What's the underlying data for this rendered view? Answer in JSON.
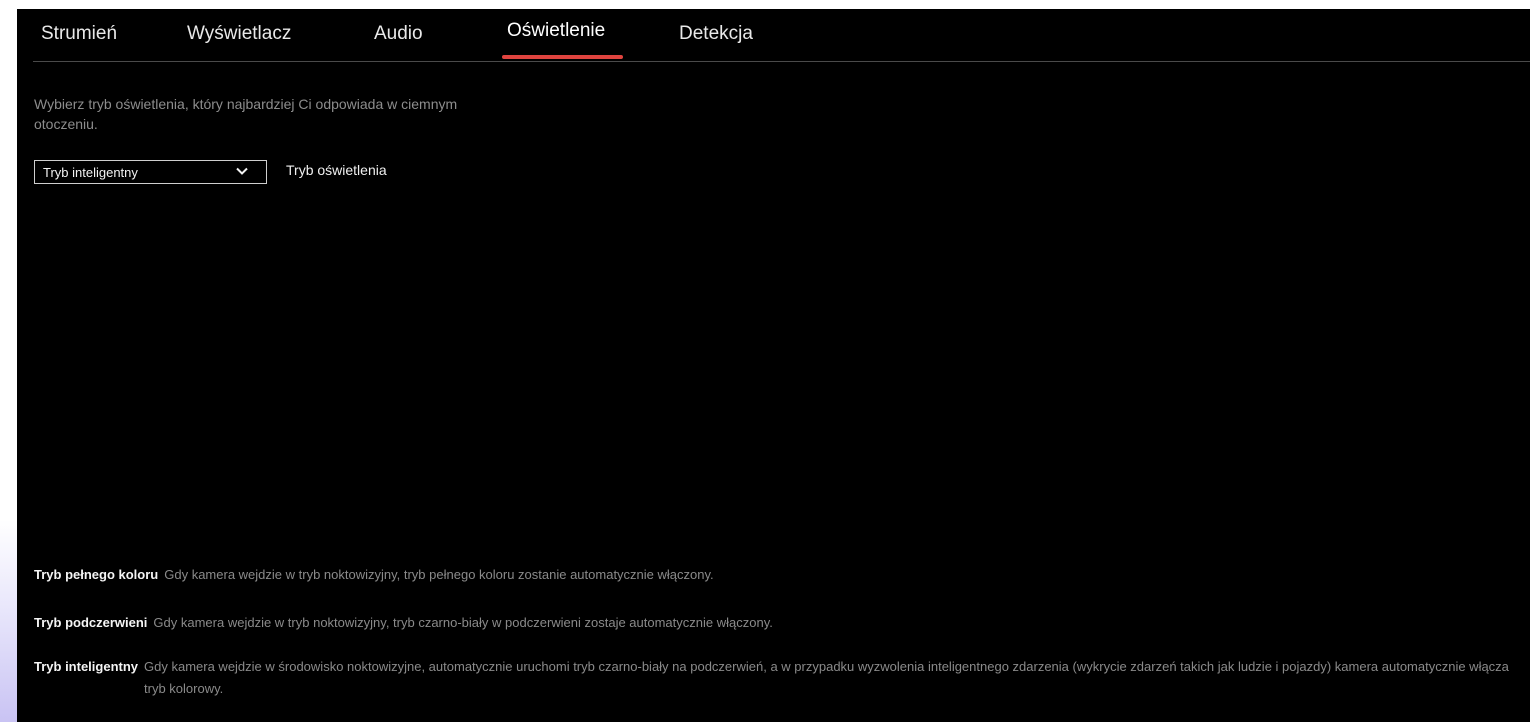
{
  "tabs": [
    {
      "label": "Strumień",
      "active": false
    },
    {
      "label": "Wyświetlacz",
      "active": false
    },
    {
      "label": "Audio",
      "active": false
    },
    {
      "label": "Oświetlenie",
      "active": true
    },
    {
      "label": "Detekcja",
      "active": false
    }
  ],
  "accent_color": "#e0443f",
  "intro_text": "Wybierz tryb oświetlenia, który najbardziej Ci odpowiada w ciemnym otoczeniu.",
  "lighting_mode": {
    "selected": "Tryb inteligentny",
    "label": "Tryb oświetlenia",
    "icon": "chevron-down-icon"
  },
  "descriptions": [
    {
      "term": "Tryb pełnego koloru",
      "text": "Gdy kamera wejdzie w tryb noktowizyjny, tryb pełnego koloru zostanie automatycznie włączony."
    },
    {
      "term": "Tryb podczerwieni",
      "text": "Gdy kamera wejdzie w tryb noktowizyjny, tryb czarno-biały w podczerwieni zostaje automatycznie włączony."
    },
    {
      "term": "Tryb inteligentny",
      "text": "Gdy kamera wejdzie w środowisko noktowizyjne, automatycznie uruchomi tryb czarno-biały na podczerwień, a w przypadku wyzwolenia inteligentnego zdarzenia (wykrycie zdarzeń takich jak ludzie i pojazdy) kamera automatycznie włącza tryb kolorowy."
    }
  ]
}
